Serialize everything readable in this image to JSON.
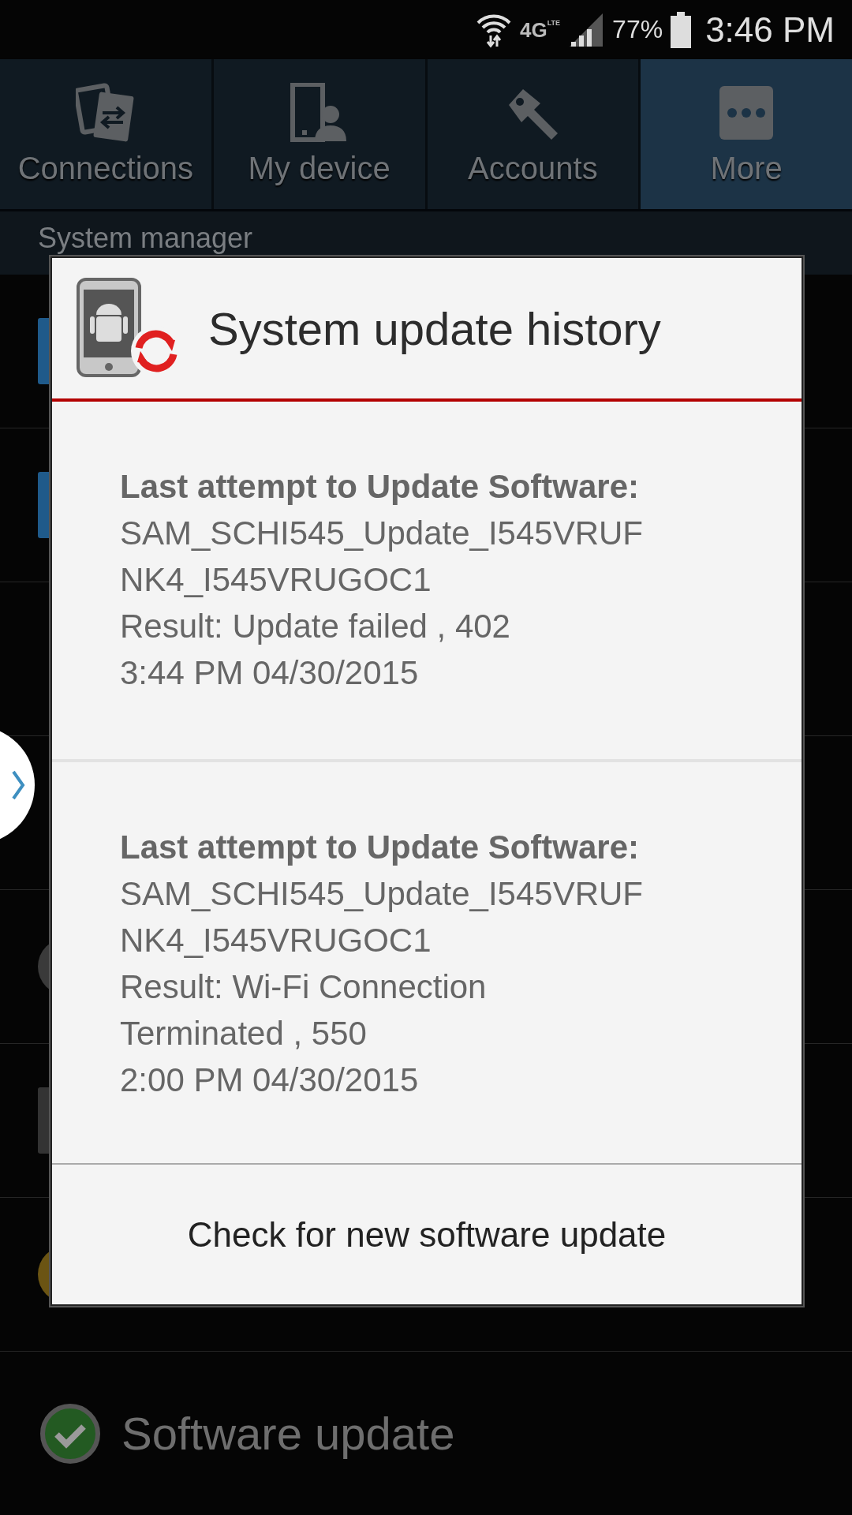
{
  "status_bar": {
    "network": "4G",
    "network_sub": "LTE",
    "battery": "77%",
    "time": "3:46 PM"
  },
  "tabs": [
    {
      "label": "Connections",
      "kind": "connections",
      "selected": false
    },
    {
      "label": "My device",
      "kind": "device",
      "selected": false
    },
    {
      "label": "Accounts",
      "kind": "accounts",
      "selected": false
    },
    {
      "label": "More",
      "kind": "more",
      "selected": true
    }
  ],
  "section_header": "System manager",
  "background_rows": [
    {
      "kind": "blue"
    },
    {
      "kind": "blue"
    },
    {
      "kind": "none"
    },
    {
      "kind": "none"
    },
    {
      "kind": "grey-circle"
    },
    {
      "kind": "grey-bar"
    },
    {
      "kind": "yellow"
    }
  ],
  "last_row": {
    "label": "Software update"
  },
  "dialog": {
    "title": "System update history",
    "entries": [
      {
        "heading": "Last attempt to Update Software:",
        "lines": [
          "SAM_SCHI545_Update_I545VRUF",
          "NK4_I545VRUGOC1",
          "Result: Update failed , 402",
          "3:44 PM 04/30/2015"
        ]
      },
      {
        "heading": "Last attempt to Update Software:",
        "lines": [
          "SAM_SCHI545_Update_I545VRUF",
          "NK4_I545VRUGOC1",
          "Result: Wi-Fi Connection",
          "Terminated , 550",
          "2:00 PM 04/30/2015"
        ]
      }
    ],
    "button": "Check for new software update"
  }
}
